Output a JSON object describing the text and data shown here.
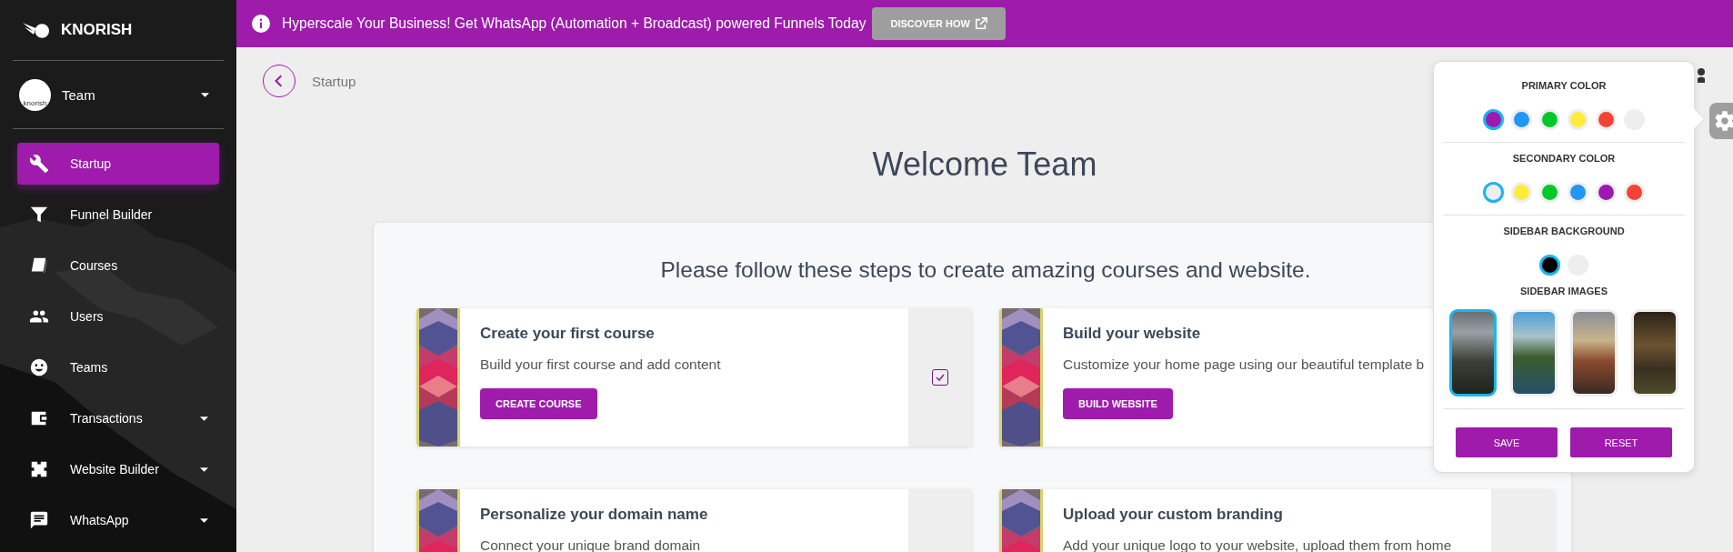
{
  "sidebar": {
    "brand": "KNORISH",
    "account": {
      "name": "Team",
      "avatar_text": "knorish"
    },
    "items": [
      {
        "label": "Startup",
        "selected": true,
        "has_submenu": false
      },
      {
        "label": "Funnel Builder",
        "selected": false,
        "has_submenu": false
      },
      {
        "label": "Courses",
        "selected": false,
        "has_submenu": false
      },
      {
        "label": "Users",
        "selected": false,
        "has_submenu": false
      },
      {
        "label": "Teams",
        "selected": false,
        "has_submenu": false
      },
      {
        "label": "Transactions",
        "selected": false,
        "has_submenu": true
      },
      {
        "label": "Website Builder",
        "selected": false,
        "has_submenu": true
      },
      {
        "label": "WhatsApp",
        "selected": false,
        "has_submenu": true
      }
    ]
  },
  "banner": {
    "text": "Hyperscale Your Business! Get WhatsApp (Automation + Broadcast) powered Funnels Today",
    "button": "DISCOVER HOW"
  },
  "breadcrumb": "Startup",
  "welcome": "Welcome Team",
  "steps": {
    "title": "Please follow these steps to create amazing courses and website.",
    "cards": [
      {
        "title": "Create your first course",
        "description": "Build your first course and add content",
        "button": "CREATE COURSE",
        "status_column": true,
        "checkbox": {
          "checked": true
        }
      },
      {
        "title": "Build your website",
        "description": "Customize your home page using our beautiful template b",
        "button": "BUILD WEBSITE"
      },
      {
        "title": "Personalize your domain name",
        "description": "Connect your unique brand domain",
        "status_column": true
      },
      {
        "title": "Upload your custom branding",
        "description": "Add your unique logo to your website, upload them from home",
        "status_column": true
      }
    ]
  },
  "settings": {
    "sections": [
      {
        "kind": "swatches",
        "title": "PRIMARY COLOR",
        "options": [
          {
            "color": "#9c1aaf",
            "selected": true
          },
          {
            "color": "#2196f3",
            "selected": false
          },
          {
            "color": "#00c82a",
            "selected": false
          },
          {
            "color": "#ffeb3b",
            "selected": false
          },
          {
            "color": "#f44336",
            "selected": false
          },
          {
            "color": "#eeeeee",
            "selected": false
          }
        ]
      },
      {
        "kind": "swatches",
        "title": "SECONDARY COLOR",
        "options": [
          {
            "color": "#eeeeee",
            "selected": true
          },
          {
            "color": "#ffeb3b",
            "selected": false
          },
          {
            "color": "#00c82a",
            "selected": false
          },
          {
            "color": "#2196f3",
            "selected": false
          },
          {
            "color": "#9c1aaf",
            "selected": false
          },
          {
            "color": "#f44336",
            "selected": false
          }
        ]
      },
      {
        "kind": "swatches",
        "title": "SIDEBAR BACKGROUND",
        "options": [
          {
            "color": "#000000",
            "selected": true
          },
          {
            "color": "#eeeeee",
            "selected": false
          }
        ]
      },
      {
        "kind": "images",
        "title": "SIDEBAR IMAGES",
        "options": [
          {
            "selected": true
          },
          {
            "selected": false
          },
          {
            "selected": false
          },
          {
            "selected": false
          }
        ]
      }
    ],
    "buttons": [
      "SAVE",
      "RESET"
    ]
  }
}
